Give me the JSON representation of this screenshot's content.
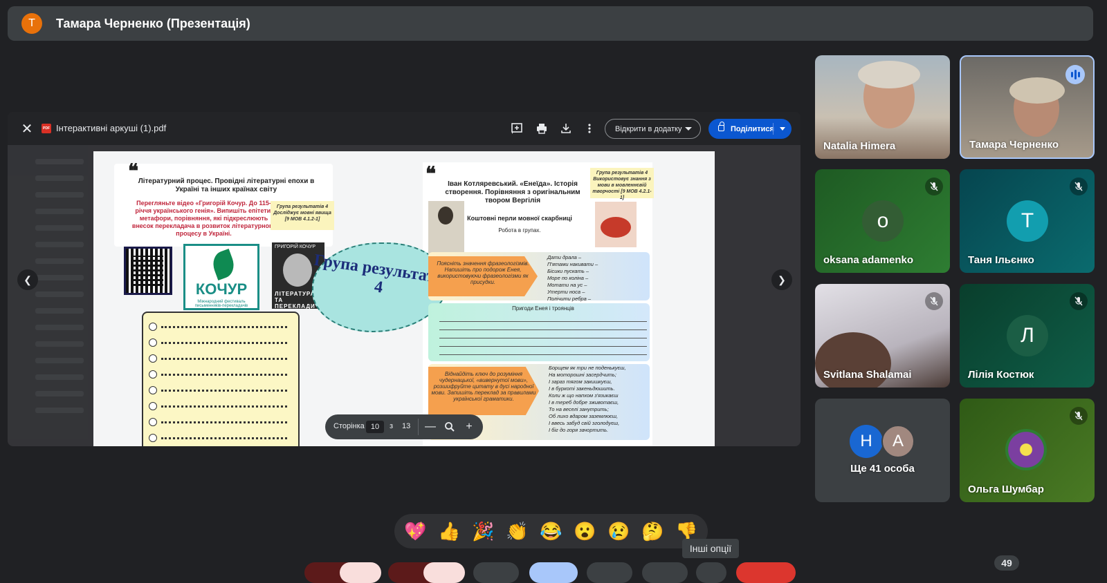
{
  "presenter": {
    "avatar_letter": "Т",
    "title": "Тамара Черненко (Презентація)"
  },
  "viewer": {
    "filename": "Інтерактивні аркуші (1).pdf",
    "file_icon": "pdf-icon",
    "open_with_label": "Відкрити в додатку",
    "share_label": "Поділитися",
    "page_label": "Сторінка",
    "page_current": "10",
    "page_of": "з",
    "page_total": "13"
  },
  "slide": {
    "left_title": "Літературний процес. Провідні літературні епохи в Україні та інших країнах світу",
    "left_text": "Перегляньте відео «Григорій Кочур. До 115-річчя українського генія». Випишіть епітети, метафори, порівняння, які підкреслюють внесок перекладача в розвиток літературного процесу в Україні.",
    "left_note": "Група результатів 4 Досліджує мовні явища [9 МОВ 4.1.2-1]",
    "kochur_logo": "КОЧУР",
    "kochur_sub": "Міжнародний фестиваль письменників-перекладачів",
    "book_author": "ГРИГОРІЙ КОЧУР",
    "book_title": "ЛІТЕРАТУРА ТА ПЕРЕКЛАДИ",
    "cloud_text": "Група результатів 4",
    "right_title": "Іван Котляревський. «Енеїда». Історія створення. Порівняння з оригінальним твором Вергілія",
    "right_note": "Група результатів 4 Використовує знання з мови в мовленнєвій творчості [9 МОВ 4.2.1-1]",
    "right_sub": "Коштовні перли мовної скарбниці",
    "right_sub2": "Робота в групах.",
    "task1": "Поясніть значення фразеологізмів. Напишіть про подорож Енея, використовуючи фразеологізми як присудки.",
    "phrases": "Дати драла –\nП'ятами накивати –\nБісики пускать –\nМоре по коліна –\nМотати на ус –\nУтерти носа –\nПолічити ребра –",
    "band_title": "Пригоди Енея і троянців",
    "task2": "Віднайдіть ключ до розуміння чудернацької, «вивернутої мови», розшифруйте цитату в дусі народної мови. Запишіть переклад за правилами української граматики.",
    "poem": "Борщем як три не поденькуєш,\nНа моторошні засердчить;\nІ зараз тягом закишкуєш,\nІ в буркоті закеньдюшить.\nКоли ж що напхом з'язикаєш\nІ в тереб добре зживотаєш,\nТо на веселі занутрить;\nОб лихо вдаром заземлюєш,\nІ ввесь забуд свій зголодуєш,\nІ біг до горя зачортить."
  },
  "participants": [
    {
      "name": "Natalia Himera",
      "type": "video"
    },
    {
      "name": "Тамара Черненко",
      "type": "video",
      "speaking": true
    },
    {
      "name": "oksana adamenko",
      "initial": "o",
      "muted": true
    },
    {
      "name": "Таня Ільєнко",
      "initial": "Т",
      "muted": true
    },
    {
      "name": "Svitlana Shalamai",
      "type": "video",
      "muted": true
    },
    {
      "name": "Лілія Костюк",
      "initial": "Л",
      "muted": true
    },
    {
      "name": "Ще 41 особа",
      "initials": [
        "Н",
        "А"
      ]
    },
    {
      "name": "Ольга Шумбар",
      "muted": true
    }
  ],
  "reactions": [
    "💖",
    "👍",
    "🎉",
    "👏",
    "😂",
    "😮",
    "😢",
    "🤔",
    "👎"
  ],
  "tooltip": "Інші опції",
  "participant_count": "49",
  "colors": {
    "accent": "#0b57d0",
    "presenter_avatar": "#e8710a",
    "speaking": "#a8c7fa"
  }
}
